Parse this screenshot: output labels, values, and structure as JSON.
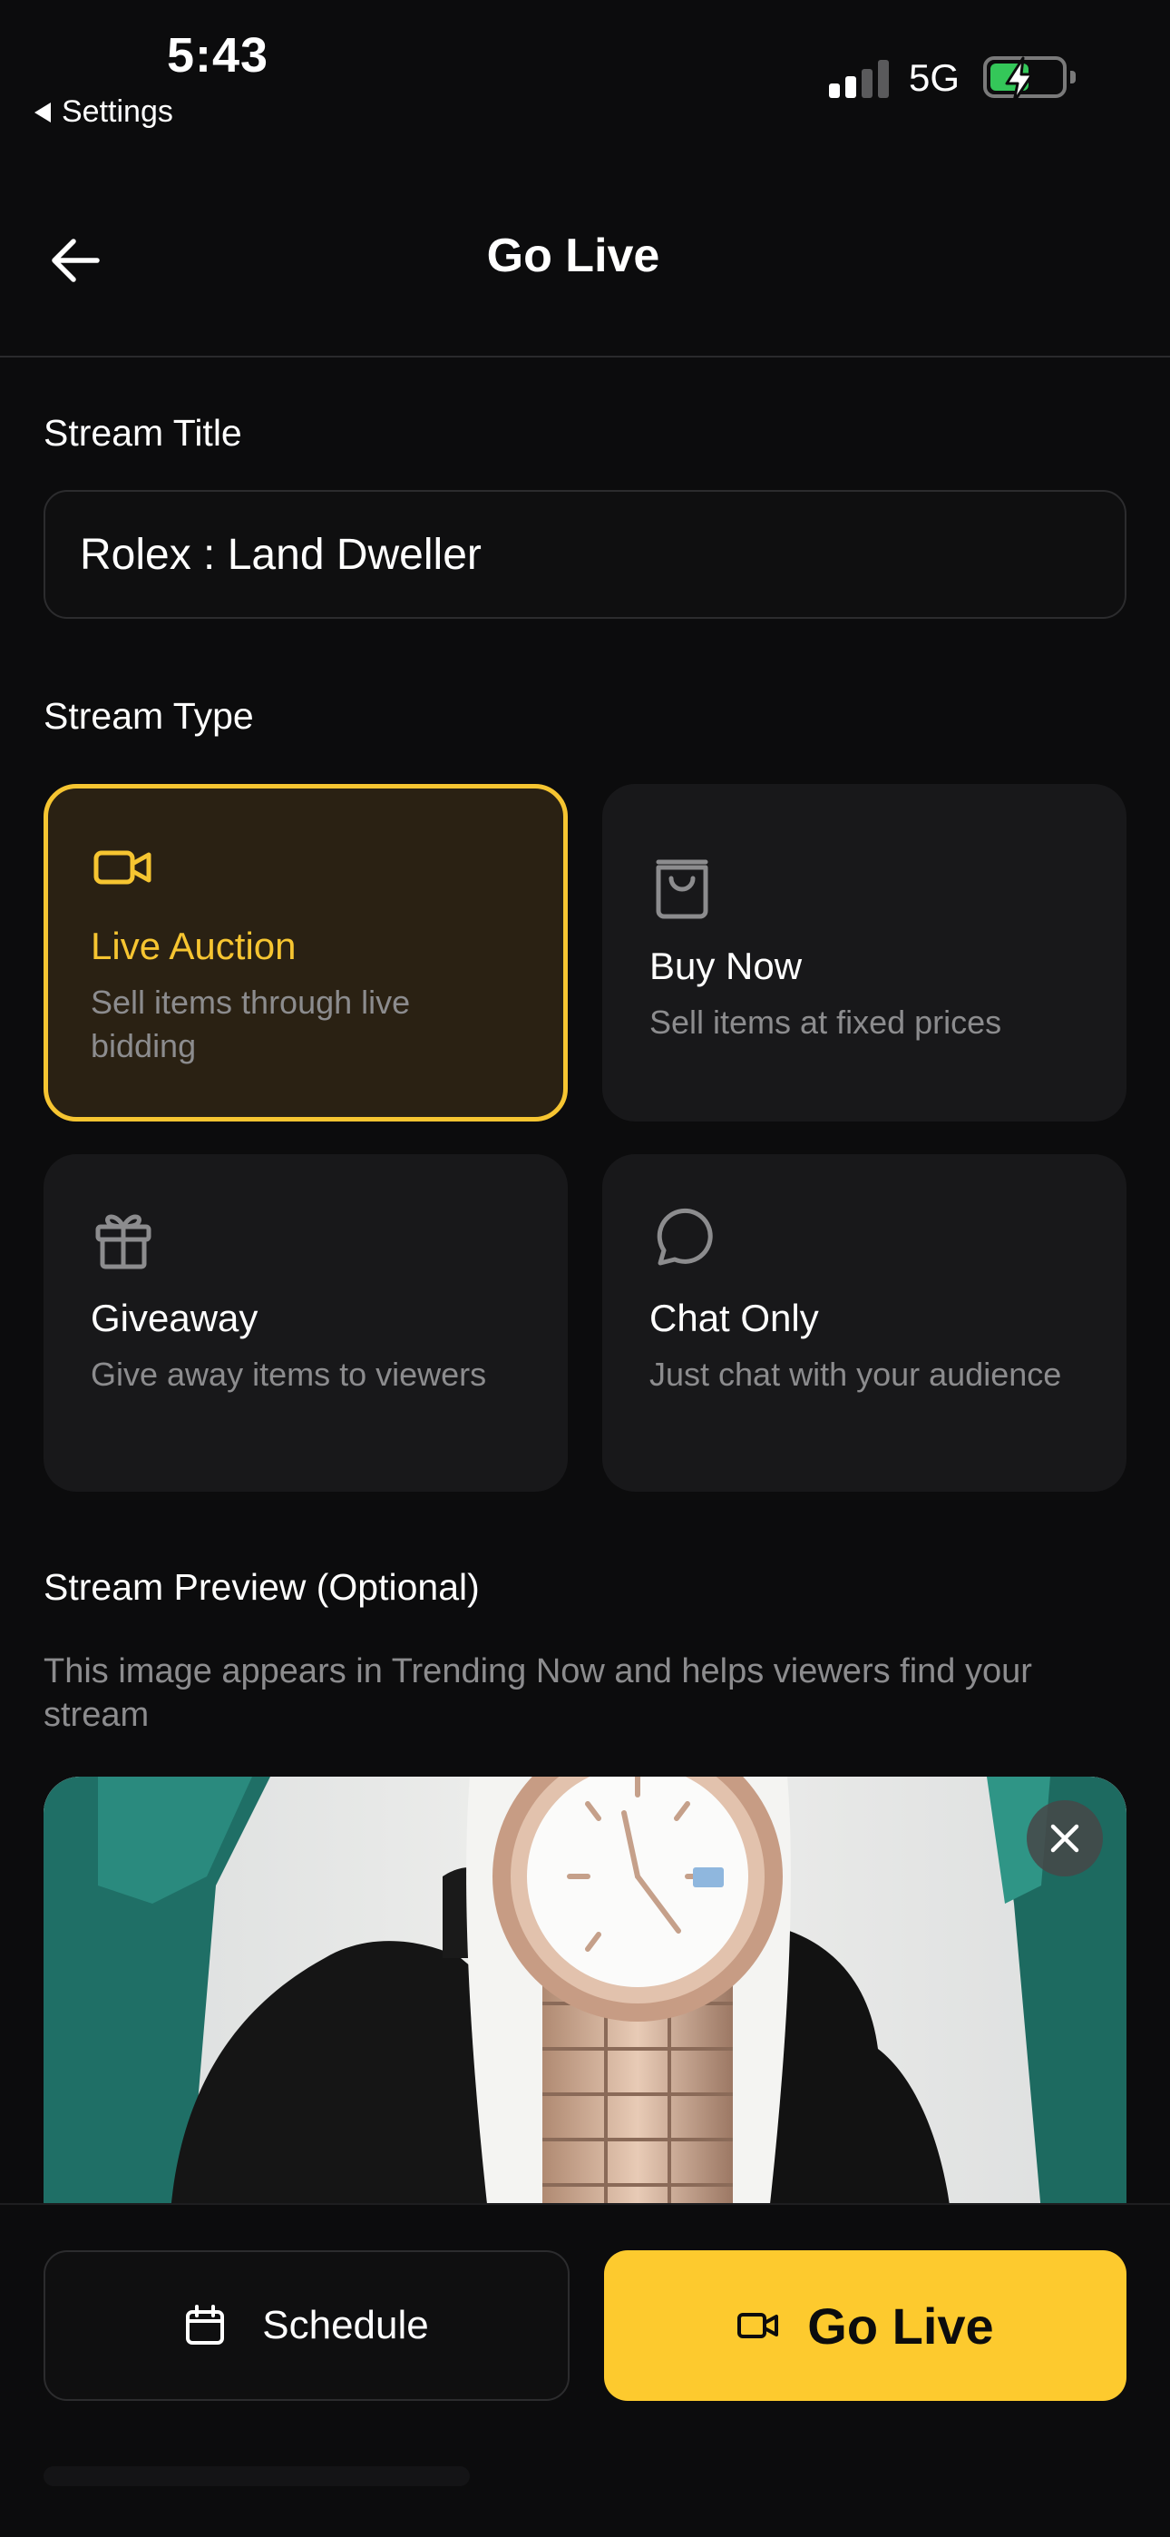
{
  "status_bar": {
    "time": "5:43",
    "back_app": "Settings",
    "network": "5G"
  },
  "header": {
    "title": "Go Live",
    "back_icon": "arrow-left-icon"
  },
  "stream_title": {
    "label": "Stream Title",
    "value": "Rolex : Land Dweller"
  },
  "stream_type": {
    "label": "Stream Type",
    "selected": "Live Auction",
    "options": [
      {
        "title": "Live Auction",
        "description": "Sell items through live bidding",
        "icon": "video-camera-icon"
      },
      {
        "title": "Buy Now",
        "description": "Sell items at fixed prices",
        "icon": "shopping-bag-icon"
      },
      {
        "title": "Giveaway",
        "description": "Give away items to viewers",
        "icon": "gift-icon"
      },
      {
        "title": "Chat Only",
        "description": "Just chat with your audience",
        "icon": "chat-bubble-icon"
      }
    ]
  },
  "stream_preview": {
    "label": "Stream Preview (Optional)",
    "description": "This image appears in Trending Now and helps viewers find your stream",
    "remove_icon": "close-icon"
  },
  "actions": {
    "schedule_label": "Schedule",
    "go_live_label": "Go Live"
  },
  "colors": {
    "accent": "#f6c531",
    "button_yellow": "#fdca2e",
    "background": "#0c0c0d",
    "card": "#18181a",
    "selected_card": "#2a2113",
    "muted_text": "#8c8c8e"
  }
}
